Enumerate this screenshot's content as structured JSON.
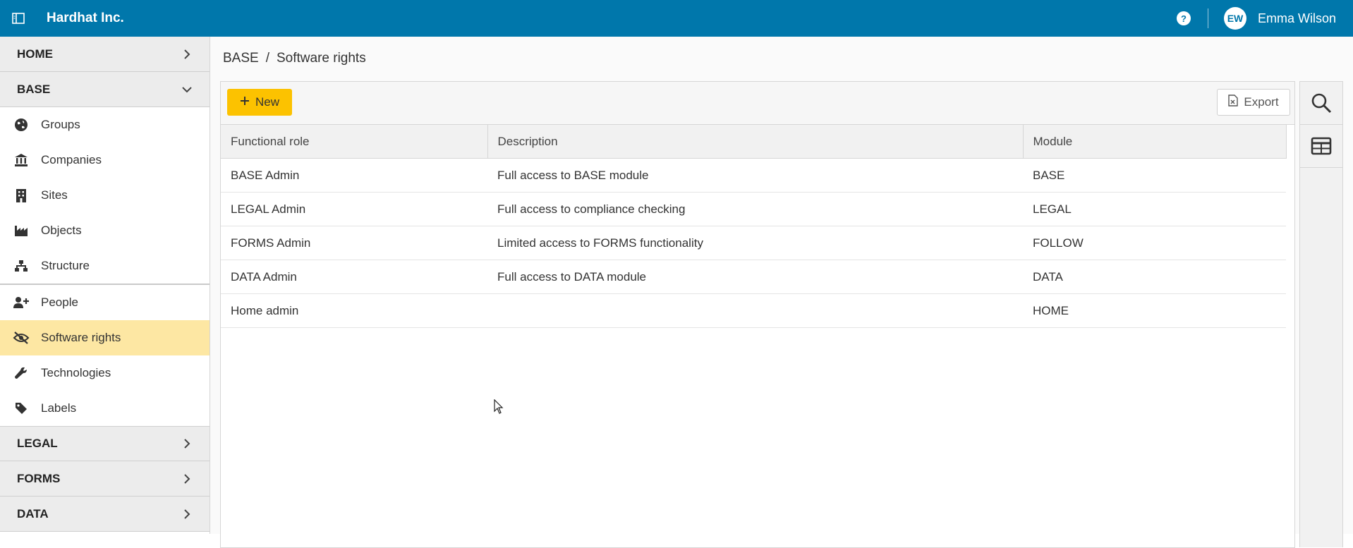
{
  "app": {
    "title": "Hardhat Inc."
  },
  "user": {
    "initials": "EW",
    "name": "Emma Wilson"
  },
  "sidebar": {
    "home": "HOME",
    "base": "BASE",
    "items": [
      {
        "label": "Groups",
        "icon": "globe-icon"
      },
      {
        "label": "Companies",
        "icon": "bank-icon"
      },
      {
        "label": "Sites",
        "icon": "building-icon"
      },
      {
        "label": "Objects",
        "icon": "factory-icon"
      },
      {
        "label": "Structure",
        "icon": "sitemap-icon"
      },
      {
        "label": "People",
        "icon": "user-plus-icon"
      },
      {
        "label": "Software rights",
        "icon": "eye-slash-icon",
        "active": true
      },
      {
        "label": "Technologies",
        "icon": "wrench-icon"
      },
      {
        "label": "Labels",
        "icon": "tag-icon"
      }
    ],
    "legal": "LEGAL",
    "forms": "FORMS",
    "data": "DATA"
  },
  "breadcrumb": {
    "parent": "BASE",
    "separator": "/",
    "current": "Software rights"
  },
  "toolbar": {
    "new_label": "New",
    "export_label": "Export"
  },
  "table": {
    "columns": [
      "Functional role",
      "Description",
      "Module"
    ],
    "rows": [
      [
        "BASE Admin",
        "Full access to BASE module",
        "BASE"
      ],
      [
        "LEGAL Admin",
        "Full access to compliance checking",
        "LEGAL"
      ],
      [
        "FORMS Admin",
        "Limited access to FORMS functionality",
        "FOLLOW"
      ],
      [
        "DATA Admin",
        "Full access to DATA module",
        "DATA"
      ],
      [
        "Home admin",
        "",
        "HOME"
      ]
    ]
  },
  "colors": {
    "topbar": "#0077ab",
    "accent": "#fcc200",
    "active_item": "#fde7a3"
  }
}
